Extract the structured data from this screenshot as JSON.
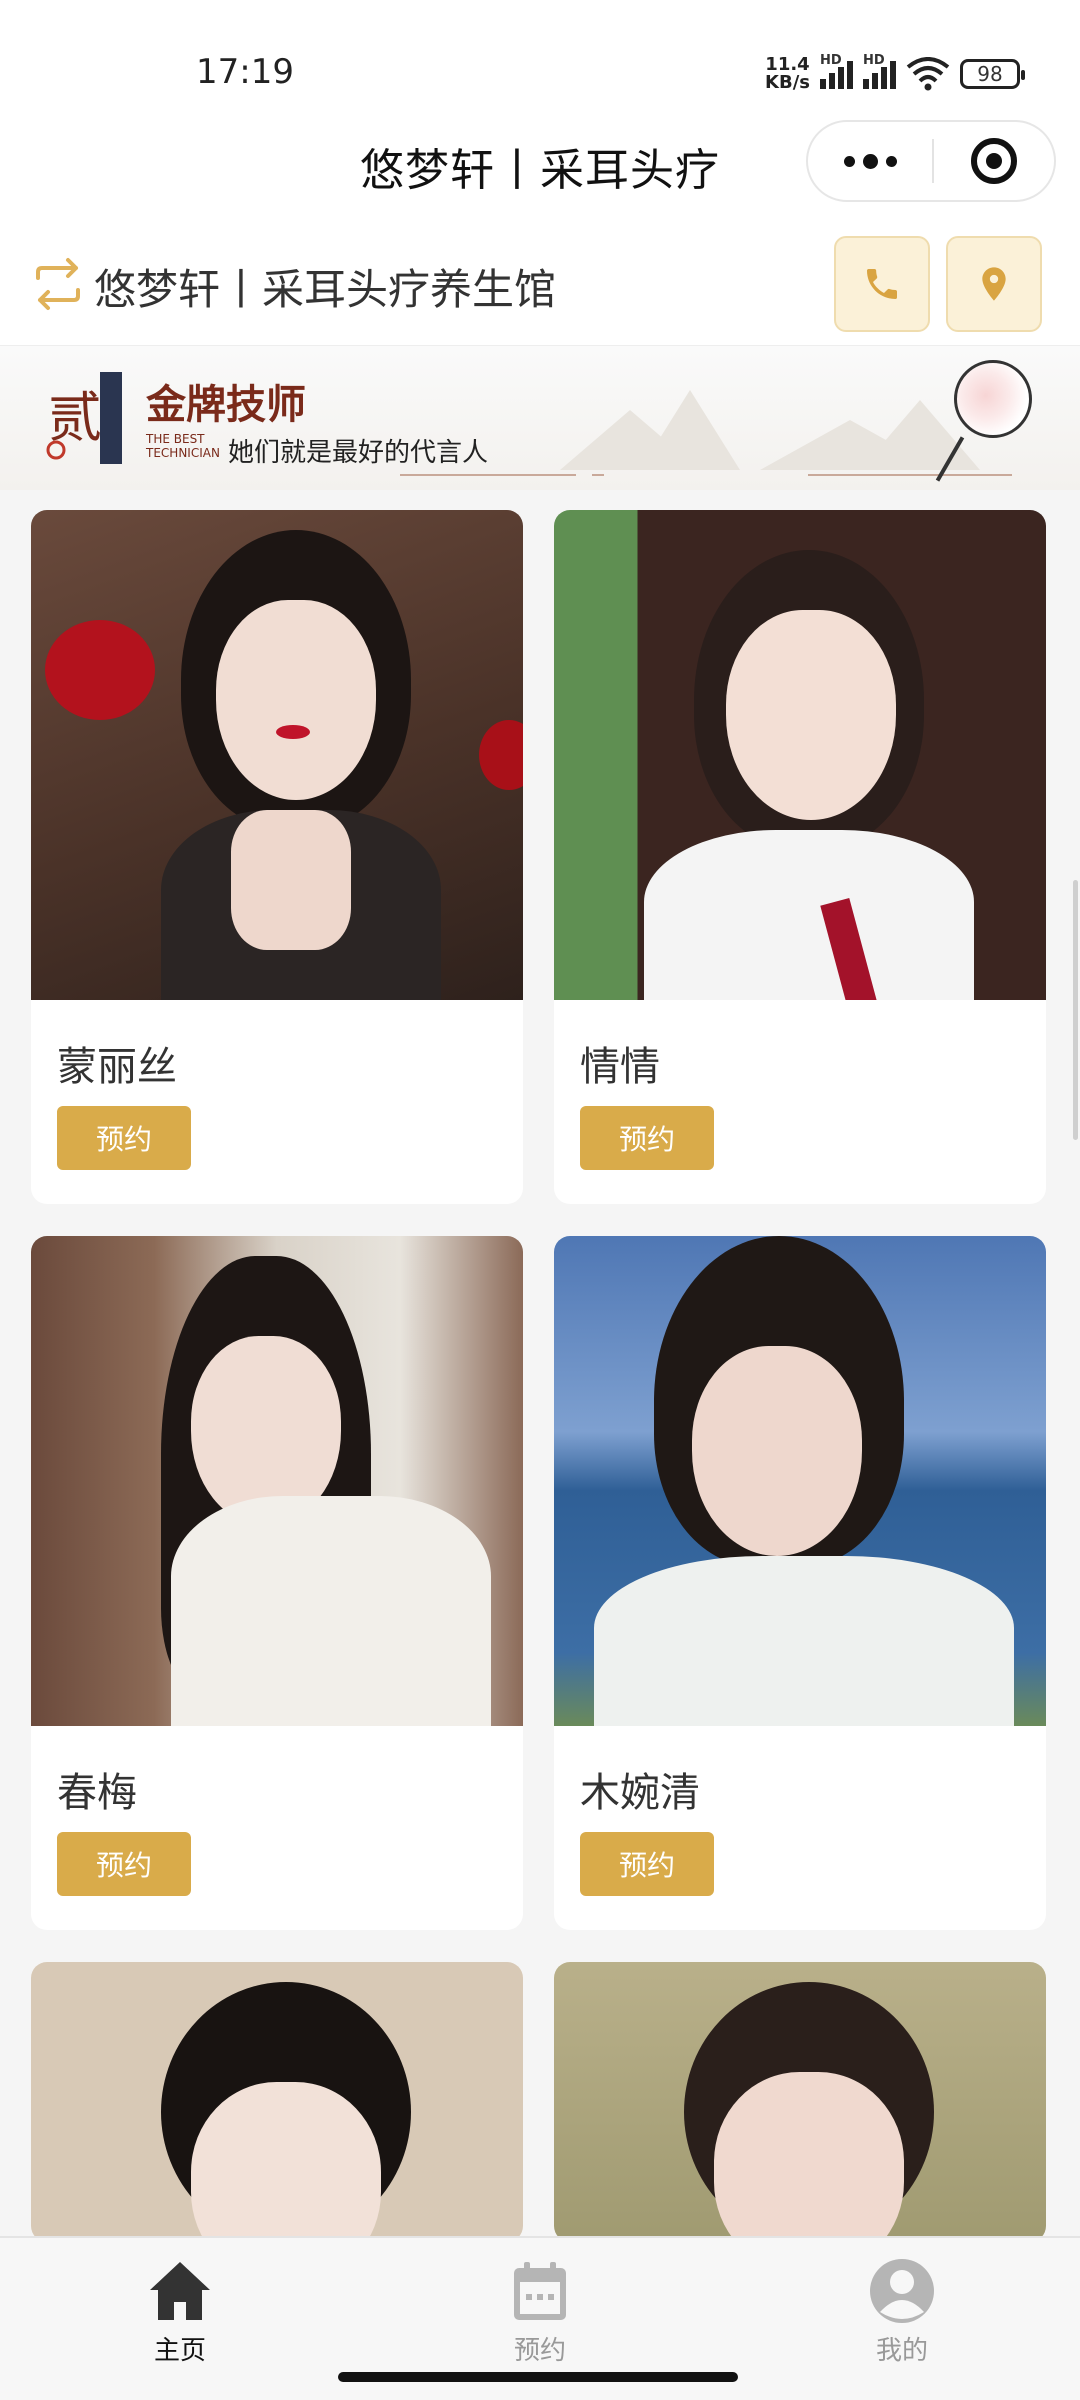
{
  "status_bar": {
    "time": "17:19",
    "net_speed_value": "11.4",
    "net_speed_unit": "KB/s",
    "hd1": "HD",
    "hd2": "HD",
    "battery": "98"
  },
  "nav": {
    "title": "悠梦轩丨采耳头疗"
  },
  "store": {
    "name": "悠梦轩丨采耳头疗养生馆",
    "accent_color": "#d9ab4a"
  },
  "banner": {
    "seal_char": "贰",
    "title": "金牌技师",
    "en_line1": "THE BEST",
    "en_line2": "TECHNICIAN",
    "subtitle": "她们就是最好的代言人"
  },
  "technicians": [
    {
      "name": "蒙丽丝",
      "book_label": "预约"
    },
    {
      "name": "情情",
      "book_label": "预约"
    },
    {
      "name": "春梅",
      "book_label": "预约"
    },
    {
      "name": "木婉清",
      "book_label": "预约"
    },
    {
      "name": "",
      "book_label": ""
    },
    {
      "name": "",
      "book_label": ""
    }
  ],
  "tabbar": {
    "items": [
      {
        "label": "主页",
        "icon": "home-icon",
        "active": true
      },
      {
        "label": "预约",
        "icon": "calendar-icon",
        "active": false
      },
      {
        "label": "我的",
        "icon": "user-icon",
        "active": false
      }
    ]
  }
}
